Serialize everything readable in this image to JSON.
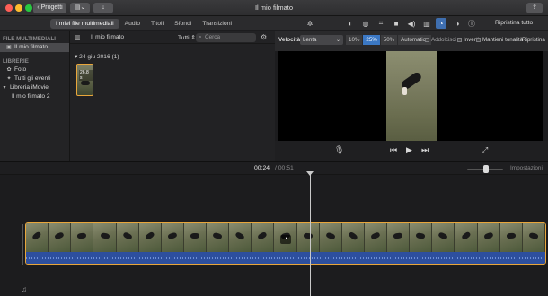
{
  "window": {
    "title": "Il mio filmato"
  },
  "titlebar": {
    "back_label": "Progetti",
    "share_icon": "share-icon"
  },
  "media_tabs": [
    {
      "label": "I miei file multimediali",
      "active": true
    },
    {
      "label": "Audio",
      "active": false
    },
    {
      "label": "Titoli",
      "active": false
    },
    {
      "label": "Sfondi",
      "active": false
    },
    {
      "label": "Transizioni",
      "active": false
    }
  ],
  "adjust_toolbar": {
    "reset_all": "Ripristina tutto",
    "active_tool": "speed-icon"
  },
  "sidebar": {
    "sections": [
      {
        "header": "FILE MULTIMEDIALI",
        "items": [
          {
            "label": "Il mio filmato",
            "selected": true
          }
        ]
      },
      {
        "header": "LIBRERIE",
        "items": [
          {
            "label": "Foto",
            "selected": false
          },
          {
            "label": "Tutti gli eventi",
            "selected": false
          },
          {
            "label": "Libreria iMovie",
            "selected": false
          },
          {
            "label": "Il mio filmato 2",
            "selected": false
          }
        ]
      }
    ]
  },
  "browser": {
    "title": "Il mio filmato",
    "filter": "Tutti",
    "search_placeholder": "Cerca",
    "date_group": "24 giu 2016",
    "date_count": "(1)",
    "clip_duration": "26,8 s"
  },
  "speed_bar": {
    "label": "Velocità:",
    "selected": "Lenta",
    "options": [
      "10%",
      "25%",
      "50%",
      "Automatico"
    ],
    "active_option": "25%",
    "checkboxes": [
      "Addolcisci",
      "Inverti",
      "Mantieni tonalità"
    ],
    "reset": "Ripristina"
  },
  "timeline": {
    "current_time": "00:24",
    "total_time": "/ 00:51",
    "settings_label": "Impostazioni",
    "frame_count": 23
  },
  "colors": {
    "accent": "#3b78c4",
    "clip_border": "#e9a63b",
    "audio": "#2d4f9e"
  }
}
